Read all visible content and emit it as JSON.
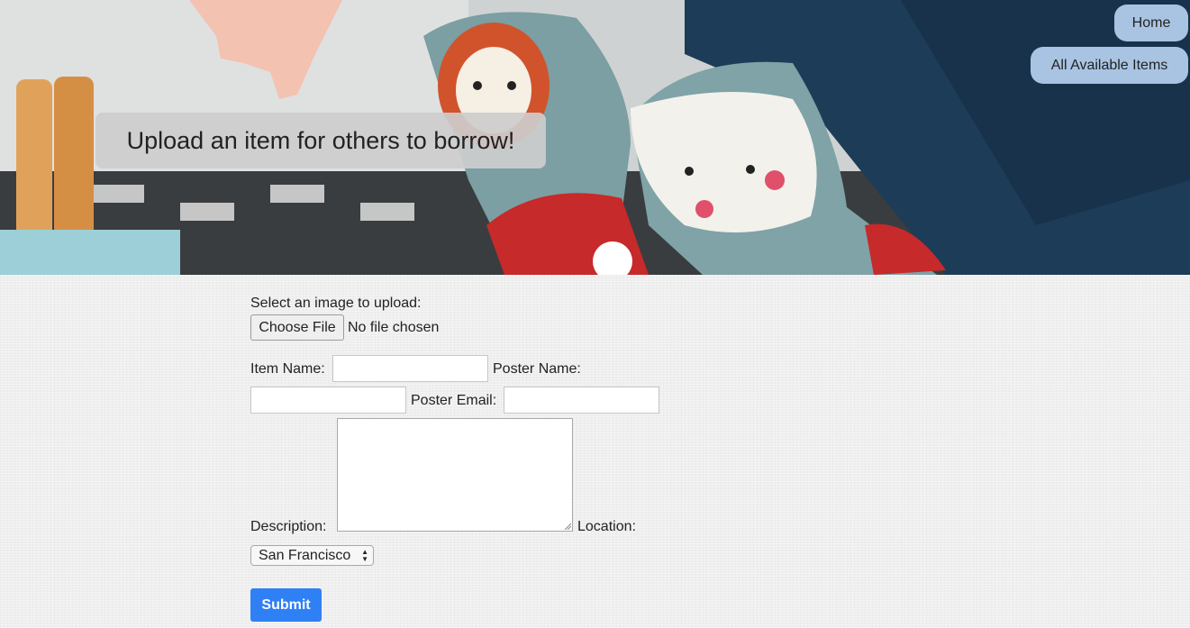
{
  "nav": {
    "home_label": "Home",
    "items_label": "All Available Items"
  },
  "hero": {
    "title": "Upload an item for others to borrow!"
  },
  "form": {
    "image_label": "Select an image to upload:",
    "file_button": "Choose File",
    "file_status": "No file chosen",
    "item_name_label": "Item Name:",
    "item_name_value": "",
    "poster_name_label": "Poster Name:",
    "poster_name_value": "",
    "poster_email_label": "Poster Email:",
    "poster_email_value": "",
    "description_label": "Description:",
    "description_value": "",
    "location_label": "Location:",
    "location_selected": "San Francisco",
    "submit_label": "Submit"
  },
  "colors": {
    "nav_button": "#a8c4e2",
    "submit_button": "#2f80f5",
    "page_bg": "#efefef"
  }
}
